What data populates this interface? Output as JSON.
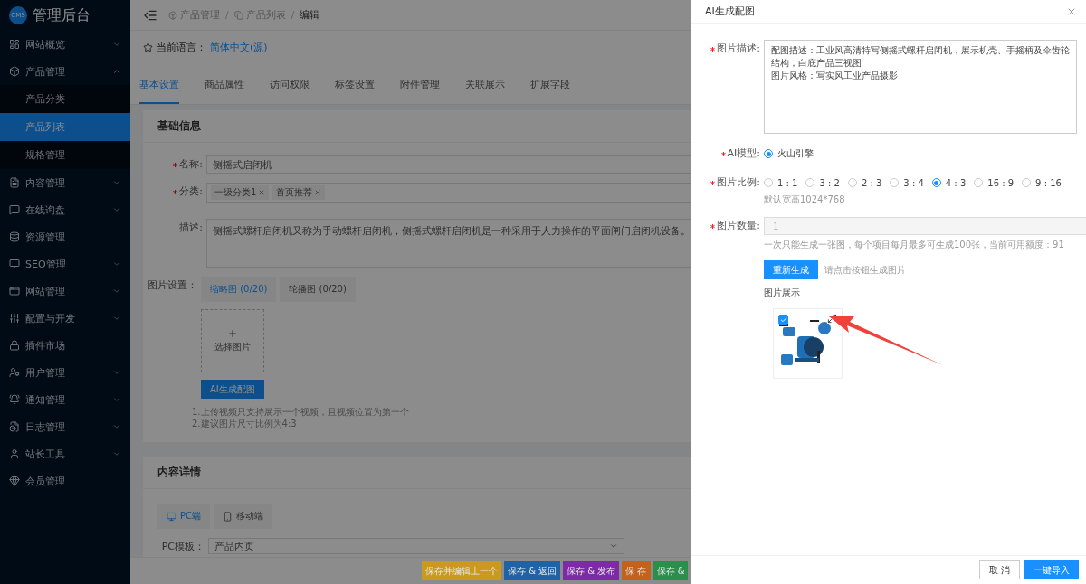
{
  "sidebar": {
    "logo": {
      "badge": "CMS",
      "title": "管理后台"
    },
    "items": [
      {
        "label": "网站概览",
        "kind": "group",
        "expanded": false
      },
      {
        "label": "产品管理",
        "kind": "group",
        "expanded": true,
        "children": [
          {
            "label": "产品分类",
            "selected": false
          },
          {
            "label": "产品列表",
            "selected": true
          },
          {
            "label": "规格管理",
            "selected": false
          }
        ]
      },
      {
        "label": "内容管理",
        "kind": "group",
        "expanded": false
      },
      {
        "label": "在线询盘",
        "kind": "group",
        "expanded": false
      },
      {
        "label": "资源管理",
        "kind": "link"
      },
      {
        "label": "SEO管理",
        "kind": "group",
        "expanded": false
      },
      {
        "label": "网站管理",
        "kind": "group",
        "expanded": false
      },
      {
        "label": "配置与开发",
        "kind": "group",
        "expanded": false
      },
      {
        "label": "插件市场",
        "kind": "link"
      },
      {
        "label": "用户管理",
        "kind": "group",
        "expanded": false
      },
      {
        "label": "通知管理",
        "kind": "group",
        "expanded": false
      },
      {
        "label": "日志管理",
        "kind": "group",
        "expanded": false
      },
      {
        "label": "站长工具",
        "kind": "group",
        "expanded": false
      },
      {
        "label": "会员管理",
        "kind": "link"
      }
    ]
  },
  "breadcrumb": {
    "items": [
      "产品管理",
      "产品列表",
      "编辑"
    ],
    "separator": "/"
  },
  "language": {
    "label": "当前语言：",
    "value": "简体中文(源)"
  },
  "tabs": [
    {
      "label": "基本设置",
      "selected": true
    },
    {
      "label": "商品属性",
      "selected": false
    },
    {
      "label": "访问权限",
      "selected": false
    },
    {
      "label": "标签设置",
      "selected": false
    },
    {
      "label": "附件管理",
      "selected": false
    },
    {
      "label": "关联展示",
      "selected": false
    },
    {
      "label": "扩展字段",
      "selected": false
    }
  ],
  "basic_info": {
    "title": "基础信息",
    "name": {
      "label": "名称:",
      "required": true,
      "value": "侧摇式启闭机"
    },
    "category": {
      "label": "分类:",
      "required": true,
      "tags": [
        "一级分类1",
        "首页推荐"
      ]
    },
    "description": {
      "label": "描述:",
      "required": false,
      "value": "侧摇式螺杆启闭机又称为手动螺杆启闭机，侧摇式螺杆启闭机是一种采用于人力操作的平面闸门启闭机设备。"
    },
    "images": {
      "label": "图片设置：",
      "tabs": [
        {
          "label": "缩略图 (0/20)",
          "selected": true
        },
        {
          "label": "轮播图 (0/20)",
          "selected": false
        }
      ],
      "upload_label": "选择图片",
      "ai_button": "AI生成配图",
      "notes": [
        "1.上传视频只支持展示一个视频，且视频位置为第一个",
        "2.建议图片尺寸比例为4:3"
      ]
    }
  },
  "content_detail": {
    "title": "内容详情",
    "tabs": [
      {
        "label": "PC端",
        "selected": true
      },
      {
        "label": "移动端",
        "selected": false
      }
    ],
    "template": {
      "label": "PC模板：",
      "value": "产品内页"
    }
  },
  "actions": [
    {
      "label": "保存并编辑上一个",
      "color": "#c99a1e"
    },
    {
      "label": "保存 & 返回",
      "color": "#1f63a6"
    },
    {
      "label": "保存 & 发布",
      "color": "#7d2aa6"
    },
    {
      "label": "保 存",
      "color": "#c2621c"
    },
    {
      "label": "保存 &",
      "color": "#2b8f4c"
    }
  ],
  "drawer": {
    "title": "AI生成配图",
    "prompt": {
      "label": "图片描述:",
      "required": true,
      "lines": [
        "配图描述：工业风高清特写侧摇式螺杆启闭机，展示机壳、手摇柄及伞齿轮结构，白底产品三视图",
        "图片风格：写实风工业产品摄影"
      ]
    },
    "model": {
      "label": "AI模型:",
      "required": true,
      "options": [
        {
          "label": "火山引擎",
          "selected": true
        }
      ]
    },
    "ratio": {
      "label": "图片比例:",
      "required": true,
      "options": [
        {
          "label": "1 : 1",
          "selected": false
        },
        {
          "label": "3 : 2",
          "selected": false
        },
        {
          "label": "2 : 3",
          "selected": false
        },
        {
          "label": "3 : 4",
          "selected": false
        },
        {
          "label": "4 : 3",
          "selected": true
        },
        {
          "label": "16 : 9",
          "selected": false
        },
        {
          "label": "9 : 16",
          "selected": false
        }
      ],
      "hint": "默认宽高1024*768"
    },
    "count": {
      "label": "图片数量:",
      "required": true,
      "value": "1",
      "disabled": true,
      "hint": "一次只能生成一张图，每个项目每月最多可生成100张，当前可用额度：91"
    },
    "generate_button": "重新生成",
    "generate_hint": "请点击按钮生成图片",
    "gallery_label": "图片展示",
    "results": [
      {
        "kind": "picture",
        "selected": true
      }
    ],
    "cancel_button": "取 消",
    "import_button": "一键导入"
  }
}
